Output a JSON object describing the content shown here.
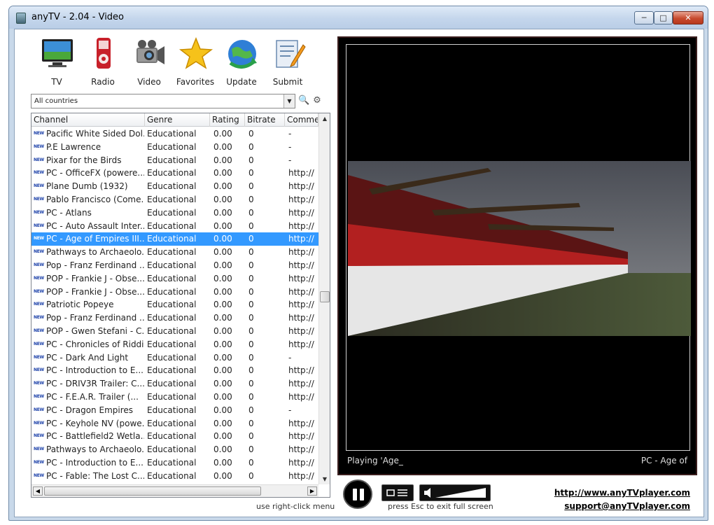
{
  "window": {
    "title": "anyTV - 2.04 - Video"
  },
  "toolbar": {
    "items": [
      {
        "label": "TV"
      },
      {
        "label": "Radio"
      },
      {
        "label": "Video"
      },
      {
        "label": "Favorites"
      },
      {
        "label": "Update"
      },
      {
        "label": "Submit"
      }
    ]
  },
  "filter": {
    "country": "All countries"
  },
  "table": {
    "headers": [
      "Channel",
      "Genre",
      "Rating",
      "Bitrate",
      "Commen"
    ],
    "new_tag": "NEW",
    "rows": [
      {
        "channel": "Pacific White Sided Dol...",
        "genre": "Educational",
        "rating": "0.00",
        "bitrate": "0",
        "comment": "-"
      },
      {
        "channel": "P.E Lawrence",
        "genre": "Educational",
        "rating": "0.00",
        "bitrate": "0",
        "comment": "-"
      },
      {
        "channel": "Pixar for the Birds",
        "genre": "Educational",
        "rating": "0.00",
        "bitrate": "0",
        "comment": "-"
      },
      {
        "channel": "PC - OfficeFX (powere...",
        "genre": "Educational",
        "rating": "0.00",
        "bitrate": "0",
        "comment": "http://"
      },
      {
        "channel": "Plane Dumb (1932)",
        "genre": "Educational",
        "rating": "0.00",
        "bitrate": "0",
        "comment": "http://"
      },
      {
        "channel": "Pablo Francisco (Come...",
        "genre": "Educational",
        "rating": "0.00",
        "bitrate": "0",
        "comment": "http://"
      },
      {
        "channel": "PC - Atlans",
        "genre": "Educational",
        "rating": "0.00",
        "bitrate": "0",
        "comment": "http://"
      },
      {
        "channel": "PC - Auto Assault Inter...",
        "genre": "Educational",
        "rating": "0.00",
        "bitrate": "0",
        "comment": "http://"
      },
      {
        "channel": "PC - Age of Empires III...",
        "genre": "Educational",
        "rating": "0.00",
        "bitrate": "0",
        "comment": "http://"
      },
      {
        "channel": "Pathways to Archaeolo...",
        "genre": "Educational",
        "rating": "0.00",
        "bitrate": "0",
        "comment": "http://"
      },
      {
        "channel": "Pop - Franz Ferdinand ...",
        "genre": "Educational",
        "rating": "0.00",
        "bitrate": "0",
        "comment": "http://"
      },
      {
        "channel": "POP - Frankie J - Obse...",
        "genre": "Educational",
        "rating": "0.00",
        "bitrate": "0",
        "comment": "http://"
      },
      {
        "channel": "POP - Frankie J - Obse...",
        "genre": "Educational",
        "rating": "0.00",
        "bitrate": "0",
        "comment": "http://"
      },
      {
        "channel": "Patriotic Popeye",
        "genre": "Educational",
        "rating": "0.00",
        "bitrate": "0",
        "comment": "http://"
      },
      {
        "channel": "Pop - Franz Ferdinand ...",
        "genre": "Educational",
        "rating": "0.00",
        "bitrate": "0",
        "comment": "http://"
      },
      {
        "channel": "POP - Gwen Stefani - C...",
        "genre": "Educational",
        "rating": "0.00",
        "bitrate": "0",
        "comment": "http://"
      },
      {
        "channel": "PC - Chronicles of Riddi...",
        "genre": "Educational",
        "rating": "0.00",
        "bitrate": "0",
        "comment": "http://"
      },
      {
        "channel": "PC - Dark And Light",
        "genre": "Educational",
        "rating": "0.00",
        "bitrate": "0",
        "comment": "-"
      },
      {
        "channel": "PC - Introduction to E...",
        "genre": "Educational",
        "rating": "0.00",
        "bitrate": "0",
        "comment": "http://"
      },
      {
        "channel": "PC - DRIV3R Trailer: C...",
        "genre": "Educational",
        "rating": "0.00",
        "bitrate": "0",
        "comment": "http://"
      },
      {
        "channel": "PC - F.E.A.R. Trailer (...",
        "genre": "Educational",
        "rating": "0.00",
        "bitrate": "0",
        "comment": "http://"
      },
      {
        "channel": "PC - Dragon Empires",
        "genre": "Educational",
        "rating": "0.00",
        "bitrate": "0",
        "comment": "-"
      },
      {
        "channel": "PC - Keyhole NV (powe...",
        "genre": "Educational",
        "rating": "0.00",
        "bitrate": "0",
        "comment": "http://"
      },
      {
        "channel": "PC - Battlefield2 Wetla...",
        "genre": "Educational",
        "rating": "0.00",
        "bitrate": "0",
        "comment": "http://"
      },
      {
        "channel": "Pathways to Archaeolo...",
        "genre": "Educational",
        "rating": "0.00",
        "bitrate": "0",
        "comment": "http://"
      },
      {
        "channel": "PC - Introduction to E...",
        "genre": "Educational",
        "rating": "0.00",
        "bitrate": "0",
        "comment": "http://"
      },
      {
        "channel": "PC - Fable: The Lost C...",
        "genre": "Educational",
        "rating": "0.00",
        "bitrate": "0",
        "comment": "http://"
      }
    ],
    "selected_index": 8,
    "hint": "use right-click menu"
  },
  "player": {
    "status_left": "Playing 'Age_",
    "status_right": "PC - Age of",
    "hint": "press Esc to exit full screen"
  },
  "links": {
    "website": "http://www.anyTVplayer.com",
    "support": "support@anyTVplayer.com"
  },
  "colors": {
    "selection": "#3399ff",
    "title_bar": "#c4d6ec",
    "player_border": "#3a1e1e",
    "new_tag": "#1a3fa8"
  }
}
